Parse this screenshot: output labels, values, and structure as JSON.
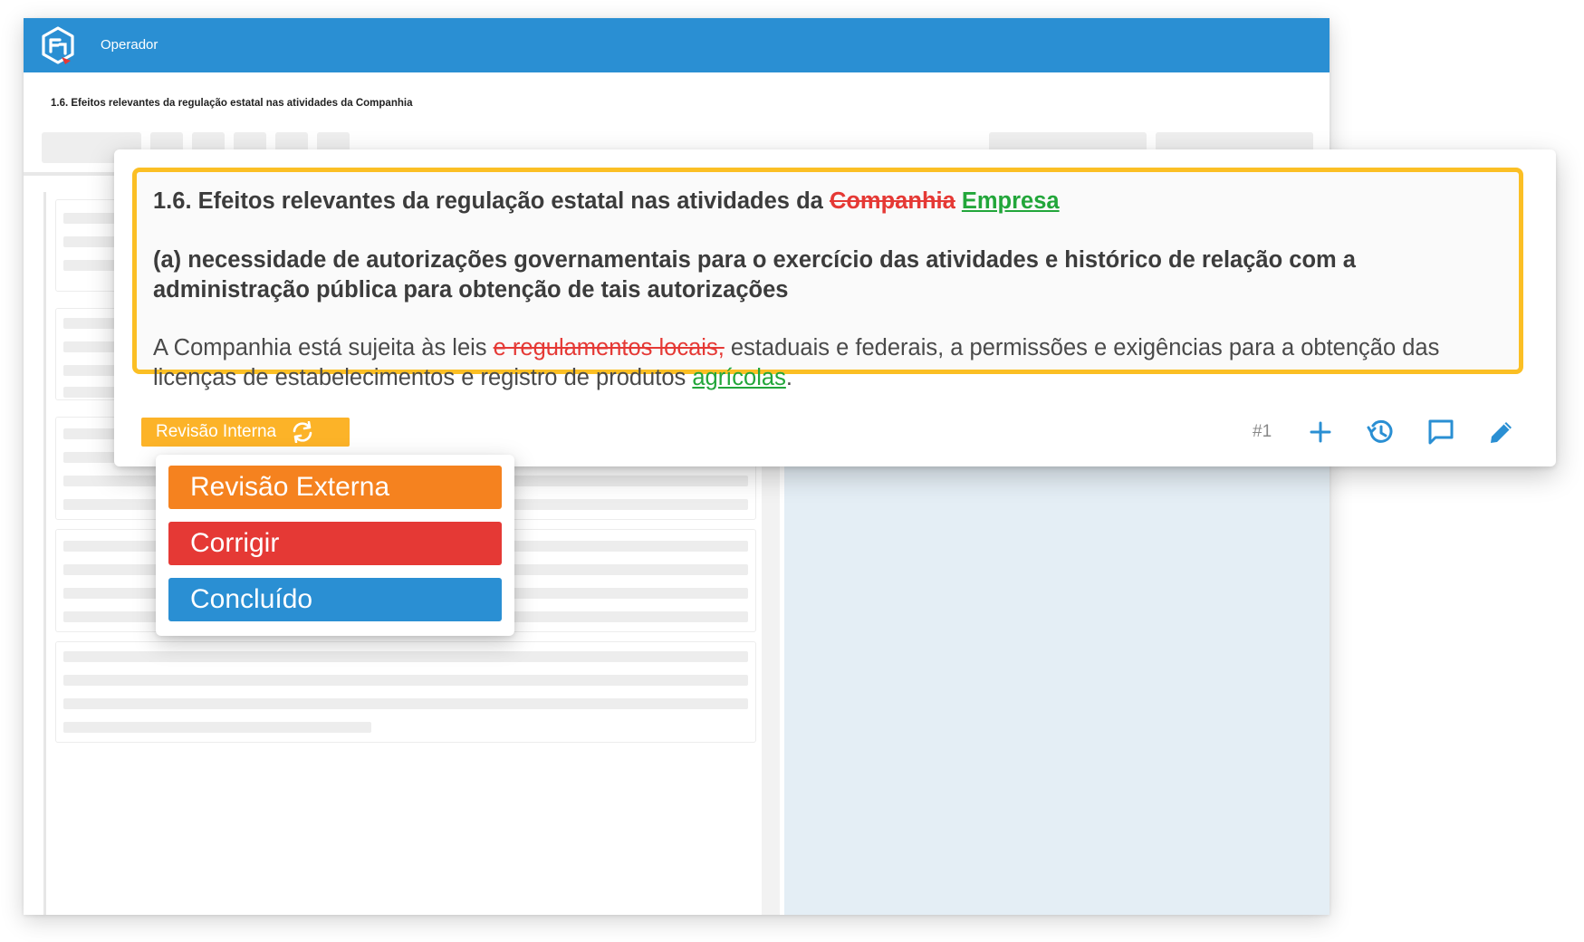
{
  "app": {
    "name": "Operador",
    "bar_color": "#2a8fd3"
  },
  "document": {
    "title": "1.6. Efeitos relevantes da regulação estatal nas atividades da Companhia"
  },
  "editor": {
    "heading1": {
      "prefix": "1.6. Efeitos relevantes da regulação estatal nas atividades da",
      "deleted": "Companhia",
      "inserted": "Empresa"
    },
    "heading2": "(a) necessidade de autorizações governamentais para o exercício das atividades e histórico de relação com a administração pública para obtenção de tais autorizações",
    "body": {
      "part1": "A Companhia está sujeita às leis",
      "deleted": "e regulamentos locais,",
      "part2": "estaduais e federais, a permissões e exigências para a obtenção das licenças de estabelecimentos e registro de produtos",
      "inserted": "agrícolas",
      "part3": "."
    },
    "status": {
      "label": "Revisão Interna",
      "icon": "sync-icon",
      "color": "#fcb328"
    },
    "index": "#1",
    "tools": [
      {
        "name": "add-icon"
      },
      {
        "name": "history-icon"
      },
      {
        "name": "comment-icon"
      },
      {
        "name": "edit-icon"
      }
    ],
    "highlight_color": "#fbbf24",
    "deleted_color": "#e53935",
    "inserted_color": "#22a63a"
  },
  "status_menu": {
    "items": [
      {
        "label": "Revisão Externa",
        "color": "#f5821f"
      },
      {
        "label": "Corrigir",
        "color": "#e53935"
      },
      {
        "label": "Concluído",
        "color": "#2a8fd3"
      }
    ]
  }
}
